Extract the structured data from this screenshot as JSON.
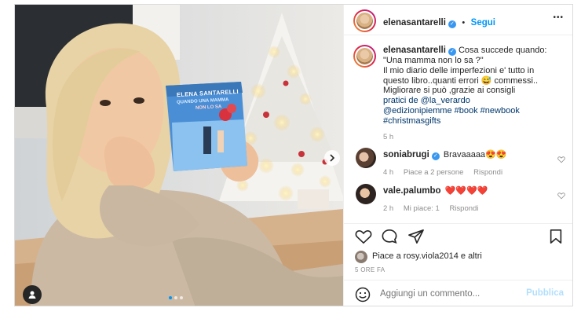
{
  "post": {
    "username": "elenasantarelli",
    "follow_label": "Segui",
    "more_label": "•••",
    "caption_lines": [
      "Cosa succede quando:",
      "\"Una mamma non lo sa ?\"",
      "Il mio diario delle imperfezioni e' tutto in",
      "questo libro..quanti errori 😅 commessi..",
      "Migliorare si può ,grazie ai consigli",
      "pratici de @la_verardo",
      "@edizionipiemme #book #newbook",
      "#christmasgifts"
    ],
    "caption_time": "5 h",
    "likes_text": "Piace a rosy.viola2014 e altri",
    "posted_time": "5 ORE FA",
    "comment_placeholder": "Aggiungi un commento...",
    "publish_label": "Pubblica",
    "carousel_dots": 3,
    "carousel_active": 0
  },
  "book": {
    "author": "ELENA SANTARELLI",
    "title_line1": "QUANDO UNA MAMMA",
    "title_line2": "NON LO SA"
  },
  "comments": [
    {
      "username": "soniabrugi",
      "verified": true,
      "text": "Bravaaaaa😍😍",
      "time": "4 h",
      "likes": "Piace a 2 persone",
      "reply": "Rispondi"
    },
    {
      "username": "vale.palumbo",
      "verified": false,
      "text": "❤️❤️❤️❤️",
      "time": "2 h",
      "likes": "Mi piace: 1",
      "reply": "Rispondi"
    }
  ],
  "colors": {
    "accent_blue": "#0095f6",
    "verified_blue": "#3897f0",
    "text_grey": "#8e8e8e",
    "border": "#dbdbdb"
  }
}
